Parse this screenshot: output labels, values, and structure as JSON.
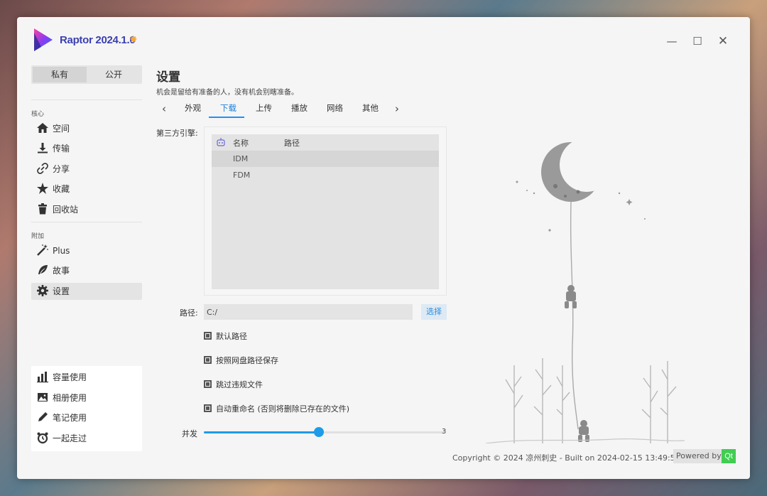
{
  "app": {
    "title": "Raptor 2024.1.0"
  },
  "colors": {
    "accent": "#1e90ff",
    "brand": "#3a3fb0",
    "qt": "#41cd52"
  },
  "window_controls": {
    "minimize": "—",
    "maximize": "☐",
    "close": "✕"
  },
  "sidebar": {
    "segments": [
      {
        "label": "私有"
      },
      {
        "label": "公开"
      }
    ],
    "groups": [
      {
        "label": "核心",
        "items": [
          {
            "label": "空间",
            "icon": "home-icon"
          },
          {
            "label": "传输",
            "icon": "download-icon"
          },
          {
            "label": "分享",
            "icon": "link-icon"
          },
          {
            "label": "收藏",
            "icon": "star-icon"
          },
          {
            "label": "回收站",
            "icon": "trash-icon"
          }
        ]
      },
      {
        "label": "附加",
        "items": [
          {
            "label": "Plus",
            "icon": "magic-wand-icon"
          },
          {
            "label": "故事",
            "icon": "feather-icon"
          },
          {
            "label": "设置",
            "icon": "gear-icon"
          }
        ]
      }
    ],
    "bottom": [
      {
        "label": "容量使用",
        "icon": "bar-chart-icon"
      },
      {
        "label": "相册使用",
        "icon": "image-icon"
      },
      {
        "label": "笔记使用",
        "icon": "pencil-icon"
      },
      {
        "label": "一起走过",
        "icon": "alarm-clock-icon"
      }
    ]
  },
  "main": {
    "title": "设置",
    "subtitle": "机会是留给有准备的人，没有机会别瞎准备。",
    "tabs": [
      "外观",
      "下载",
      "上传",
      "播放",
      "网络",
      "其他"
    ],
    "active_tab": "下载",
    "engine": {
      "label": "第三方引擎:",
      "columns": [
        "名称",
        "路径"
      ],
      "rows": [
        {
          "name": "IDM"
        },
        {
          "name": "FDM"
        }
      ]
    },
    "path": {
      "label": "路径:",
      "value": "C:/",
      "button": "选择"
    },
    "checks": [
      {
        "label": "默认路径"
      },
      {
        "label": "按照网盘路径保存"
      },
      {
        "label": "跳过违规文件"
      },
      {
        "label": "自动重命名 (否则将删除已存在的文件)"
      }
    ],
    "concurrency": {
      "label": "并发",
      "value": "3",
      "fraction": 0.48
    }
  },
  "footer": {
    "copyright": "Copyright © 2024 凉州刺史 - Built on 2024-02-15 13:49:59",
    "powered_by": "Powered by",
    "qt": "Qt"
  }
}
